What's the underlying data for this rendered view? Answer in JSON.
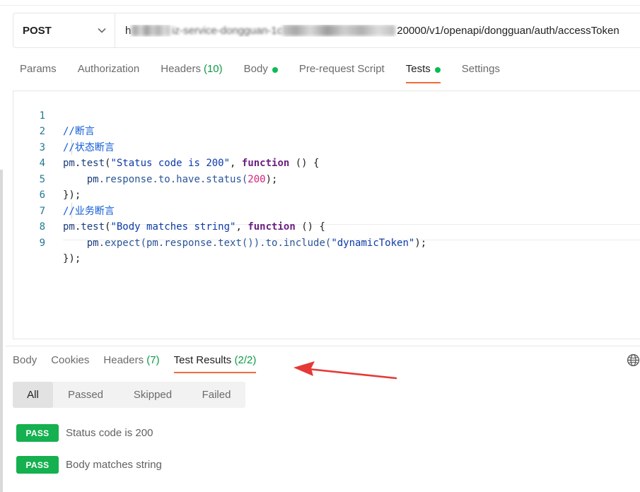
{
  "request": {
    "method": "POST",
    "url_visible_start": "h",
    "url_middle_fragment": "iz-service-dongguan-1c",
    "url_visible_end": "20000/v1/openapi/dongguan/auth/accessToken"
  },
  "request_tabs": [
    {
      "label": "Params"
    },
    {
      "label": "Authorization"
    },
    {
      "label": "Headers",
      "count": "(10)"
    },
    {
      "label": "Body",
      "dot": true
    },
    {
      "label": "Pre-request Script"
    },
    {
      "label": "Tests",
      "dot": true,
      "active": true
    },
    {
      "label": "Settings"
    }
  ],
  "editor": {
    "line_numbers": [
      "1",
      "2",
      "3",
      "4",
      "5",
      "6",
      "7",
      "8",
      "9"
    ],
    "lines": [
      {
        "comment": "//断言"
      },
      {
        "comment": "//状态断言"
      },
      {
        "obj": "pm",
        "dot": ".",
        "method": "test",
        "open": "(",
        "string": "\"Status code is 200\"",
        "comma": ", ",
        "keyword": "function",
        "rest": " () {"
      },
      {
        "indent": "    ",
        "obj": "pm",
        "chain": ".response.to.have.status(",
        "number": "200",
        "close": ");"
      },
      {
        "text": "});"
      },
      {
        "comment": "//业务断言"
      },
      {
        "obj": "pm",
        "dot": ".",
        "method": "test",
        "open": "(",
        "string": "\"Body matches string\"",
        "comma": ", ",
        "keyword": "function",
        "rest": " () {"
      },
      {
        "indent": "    ",
        "obj": "pm",
        "chain": ".expect(pm.response.text()).to.include(",
        "string": "\"dynamicToken\"",
        "close": ");"
      },
      {
        "text": "});"
      }
    ]
  },
  "response_tabs": [
    {
      "label": "Body"
    },
    {
      "label": "Cookies"
    },
    {
      "label": "Headers",
      "count": " (7)"
    },
    {
      "label": "Test Results",
      "count": " (2/2)",
      "active": true
    }
  ],
  "filters": [
    "All",
    "Passed",
    "Skipped",
    "Failed"
  ],
  "results": [
    {
      "status": "PASS",
      "name": "Status code is 200"
    },
    {
      "status": "PASS",
      "name": "Body matches string"
    }
  ],
  "colors": {
    "accent": "#f26b3a",
    "pass": "#15b04f",
    "dot": "#0cbb52",
    "arrow": "#e53935"
  },
  "icons": {
    "method_dropdown": "chevron-down-icon",
    "globe": "globe-icon",
    "annotation": "arrow-icon"
  }
}
